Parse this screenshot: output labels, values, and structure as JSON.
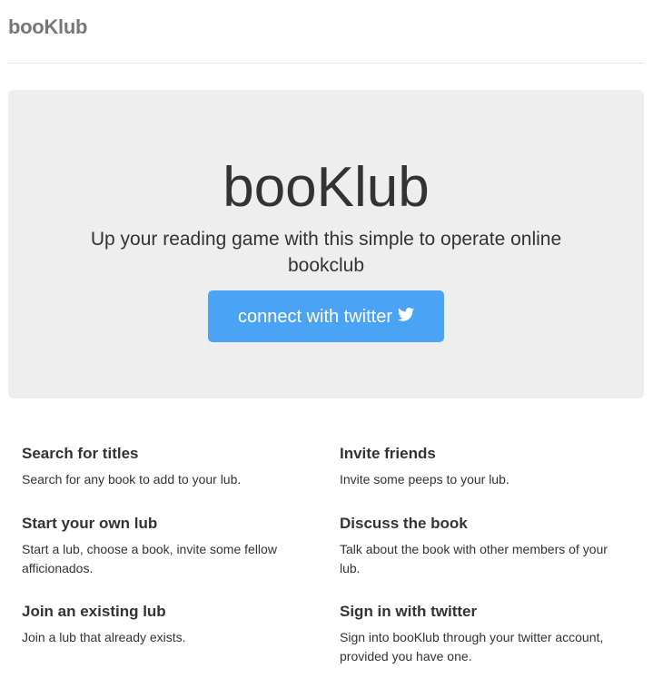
{
  "header": {
    "brand": "booKlub"
  },
  "jumbotron": {
    "title": "booKlub",
    "lead": "Up your reading game with this simple to operate online bookclub",
    "cta_label": "connect with twitter",
    "cta_icon": "twitter-bird-icon",
    "cta_color": "#4aa3f5",
    "background": "#eeeeee"
  },
  "features": {
    "left": [
      {
        "title": "Search for titles",
        "text": "Search for any book to add to your lub."
      },
      {
        "title": "Start your own lub",
        "text": "Start a lub, choose a book, invite some fellow afficionados."
      },
      {
        "title": "Join an existing lub",
        "text": "Join a lub that already exists."
      }
    ],
    "right": [
      {
        "title": "Invite friends",
        "text": "Invite some peeps to your lub."
      },
      {
        "title": "Discuss the book",
        "text": "Talk about the book with other members of your lub."
      },
      {
        "title": "Sign in with twitter",
        "text": "Sign into booKlub through your twitter account, provided you have one."
      }
    ]
  }
}
